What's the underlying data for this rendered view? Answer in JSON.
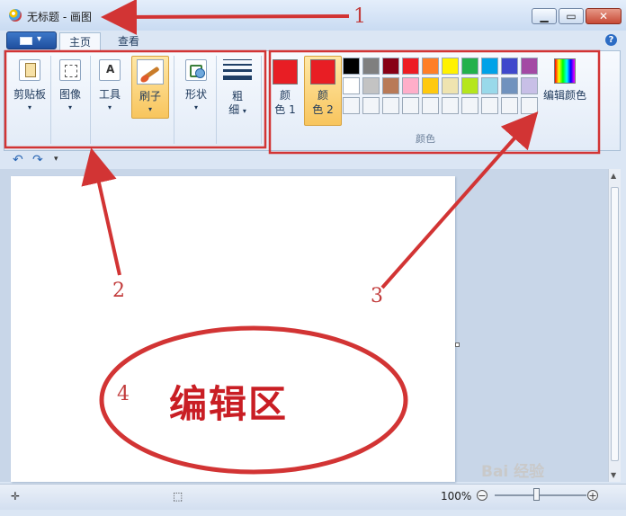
{
  "window": {
    "title": "无标题 - 画图"
  },
  "tabs": {
    "home": "主页",
    "view": "查看"
  },
  "help_label": "?",
  "toolbar": {
    "clipboard": "剪贴板",
    "image": "图像",
    "tools": "工具",
    "brushes": "刷子",
    "shapes": "形状",
    "size_line1": "粗",
    "size_line2": "细",
    "dropdown": "▾"
  },
  "colors": {
    "color1_line1": "颜",
    "color1_line2": "色 1",
    "color2_line1": "颜",
    "color2_line2": "色 2",
    "edit_colors": "编辑颜色",
    "group_label": "颜色",
    "palette_row1": [
      "#000000",
      "#7f7f7f",
      "#880015",
      "#ed1c24",
      "#ff7f27",
      "#fff200",
      "#22b14c",
      "#00a2e8",
      "#3f48cc",
      "#a349a4"
    ],
    "palette_row2": [
      "#ffffff",
      "#c3c3c3",
      "#b97a57",
      "#ffaec9",
      "#ffc90e",
      "#efe4b0",
      "#b5e61d",
      "#99d9ea",
      "#7092be",
      "#c8bfe7"
    ]
  },
  "status": {
    "zoom": "100%",
    "zoom_minus": "−",
    "zoom_plus": "+"
  },
  "annotations": {
    "n1": "1",
    "n2": "2",
    "n3": "3",
    "n4": "4",
    "edit_area": "编辑区",
    "accent_color": "#d23434"
  },
  "watermark": "Bai 经验"
}
